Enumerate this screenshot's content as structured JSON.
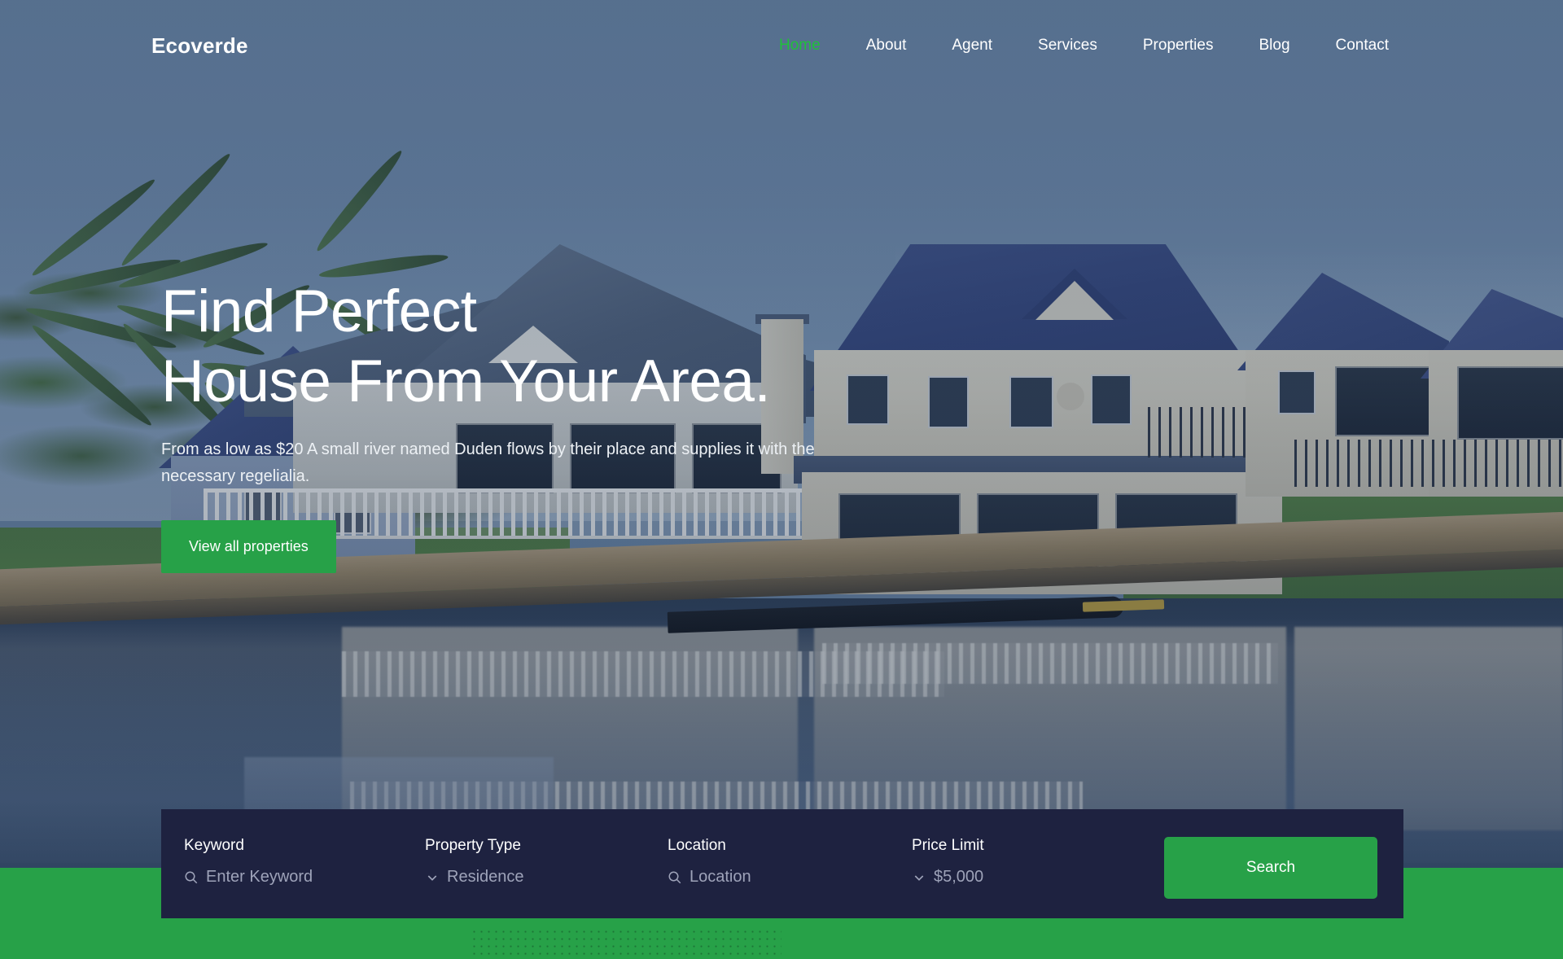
{
  "brand": {
    "name": "Ecoverde"
  },
  "nav": {
    "items": [
      {
        "label": "Home",
        "active": true
      },
      {
        "label": "About",
        "active": false
      },
      {
        "label": "Agent",
        "active": false
      },
      {
        "label": "Services",
        "active": false
      },
      {
        "label": "Properties",
        "active": false
      },
      {
        "label": "Blog",
        "active": false
      },
      {
        "label": "Contact",
        "active": false
      }
    ]
  },
  "hero": {
    "title_line1": "Find Perfect",
    "title_line2": "House From Your Area.",
    "subtitle": "From as low as $20 A small river named Duden flows by their place and supplies it with the necessary regelialia.",
    "cta_label": "View all properties"
  },
  "search": {
    "fields": [
      {
        "label": "Keyword",
        "value": "Enter Keyword",
        "icon": "search-icon"
      },
      {
        "label": "Property Type",
        "value": "Residence",
        "icon": "chevron-down-icon"
      },
      {
        "label": "Location",
        "value": "Location",
        "icon": "search-icon"
      },
      {
        "label": "Price Limit",
        "value": "$5,000",
        "icon": "chevron-down-icon"
      }
    ],
    "button_label": "Search"
  },
  "colors": {
    "accent_green": "#27a148",
    "panel_navy": "#1e2240",
    "nav_active": "#1fc13a",
    "text_white": "#ffffff",
    "placeholder": "#9ea3b9"
  }
}
